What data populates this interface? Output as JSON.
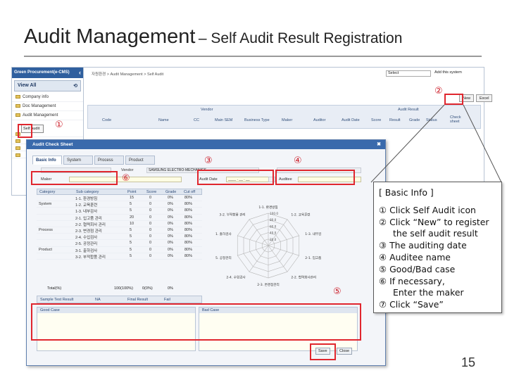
{
  "slide": {
    "title_main": "Audit Management",
    "title_sub": "– Self Audit Result Registration",
    "page_number": "15"
  },
  "app": {
    "brand": "Green Procurement(e-CMS)",
    "view_all": "View All",
    "sidebar": [
      {
        "label": "Company info"
      },
      {
        "label": "Doc Management"
      },
      {
        "label": "Audit Management"
      }
    ],
    "self_audit_link": "Self Audit",
    "breadcrumb": "자원환경 > Audit Management > Self Audit",
    "select_value": "Select",
    "add_my_system": "Add this system",
    "new_button": "New",
    "excel_button": "Excel",
    "grid": {
      "group_vendor": "Vendor",
      "group_result": "Audit Result",
      "columns": [
        "Code",
        "Name",
        "CC",
        "Main SEM",
        "Business Type",
        "Maker",
        "Auditor",
        "Audit Date",
        "Score",
        "Result",
        "Grade",
        "Status",
        "Check sheet"
      ]
    }
  },
  "popup": {
    "title": "Audit Check Sheet",
    "tabs": [
      "Basic Info",
      "System",
      "Process",
      "Product"
    ],
    "vendor_label": "Vendor",
    "vendor_value": "SAMSUNG ELECTRO-MECHANICS",
    "maker_label": "Maker",
    "audit_date_label": "Audit Date",
    "audit_date_value": "____ . __ . __",
    "auditee_label": "Auditee",
    "table_headers": [
      "Category",
      "Sub category",
      "Point",
      "Score",
      "Grade",
      "Cut off"
    ],
    "rows": [
      {
        "category": "",
        "sub": "1-1. 환경방침",
        "point": "15",
        "score": "0",
        "grade": "0%",
        "cutoff": "80%"
      },
      {
        "category": "System",
        "sub": "1-2. 교육훈련",
        "point": "5",
        "score": "0",
        "grade": "0%",
        "cutoff": "80%"
      },
      {
        "category": "",
        "sub": "1-3. 내부감사",
        "point": "5",
        "score": "0",
        "grade": "0%",
        "cutoff": "80%"
      },
      {
        "category": "",
        "sub": "2-1. 입고품 관리",
        "point": "20",
        "score": "0",
        "grade": "0%",
        "cutoff": "80%"
      },
      {
        "category": "",
        "sub": "2-2. 협력회사 관리",
        "point": "10",
        "score": "0",
        "grade": "0%",
        "cutoff": "80%"
      },
      {
        "category": "Process",
        "sub": "2-3. 변경점 관리",
        "point": "5",
        "score": "0",
        "grade": "0%",
        "cutoff": "80%"
      },
      {
        "category": "",
        "sub": "2-4. 수입검사",
        "point": "5",
        "score": "0",
        "grade": "0%",
        "cutoff": "80%"
      },
      {
        "category": "",
        "sub": "2-5. 공정관리",
        "point": "5",
        "score": "0",
        "grade": "0%",
        "cutoff": "80%"
      },
      {
        "category": "Product",
        "sub": "3-1. 출하검사",
        "point": "5",
        "score": "0",
        "grade": "0%",
        "cutoff": "80%"
      },
      {
        "category": "",
        "sub": "3-2. 부적합품 관리",
        "point": "5",
        "score": "0",
        "grade": "0%",
        "cutoff": "80%"
      }
    ],
    "total": {
      "label": "Total(%)",
      "point": "100(100%)",
      "score": "0(0%)",
      "grade": "0%"
    },
    "sample_test_label": "Sample Test Result",
    "sample_test_value": "NA",
    "final_result_label": "Final Result",
    "final_result_value": "Fail",
    "radar_labels": [
      "1-1. 환경방침",
      "1-2. 교육훈련",
      "1-3. 내부감사",
      "2-1. 입고품 관리",
      "2-2. 협력회사관리",
      "2-3. 변경점관리",
      "2-4. 수입검사",
      "2-5. 공정관리",
      "3-1. 출하검사",
      "3-2. 부적합품 관리"
    ],
    "radar_ticks": [
      "100.0",
      "80.0",
      "60.0",
      "40.0",
      "20.0"
    ],
    "good_case_label": "Good Case",
    "bad_case_label": "Bad Case",
    "save_button": "Save",
    "close_button": "Close"
  },
  "markers": [
    "①",
    "②",
    "③",
    "④",
    "⑤",
    "⑥"
  ],
  "info_box": {
    "heading": "[ Basic Info ]",
    "items": [
      {
        "num": "①",
        "text": "Click Self Audit icon"
      },
      {
        "num": "②",
        "text": "Click “New” to register",
        "cont": "the self audit result"
      },
      {
        "num": "③",
        "text": "The auditing date"
      },
      {
        "num": "④",
        "text": "Auditee name"
      },
      {
        "num": "⑤",
        "text": "Good/Bad case"
      },
      {
        "num": "⑥",
        "text": "If necessary,",
        "cont": "Enter the maker"
      },
      {
        "num": "⑦",
        "text": "Click “Save”"
      }
    ]
  },
  "colors": {
    "highlight": "#e0262e",
    "brand": "#2f5f9e",
    "input_yellow": "#fffde3"
  }
}
